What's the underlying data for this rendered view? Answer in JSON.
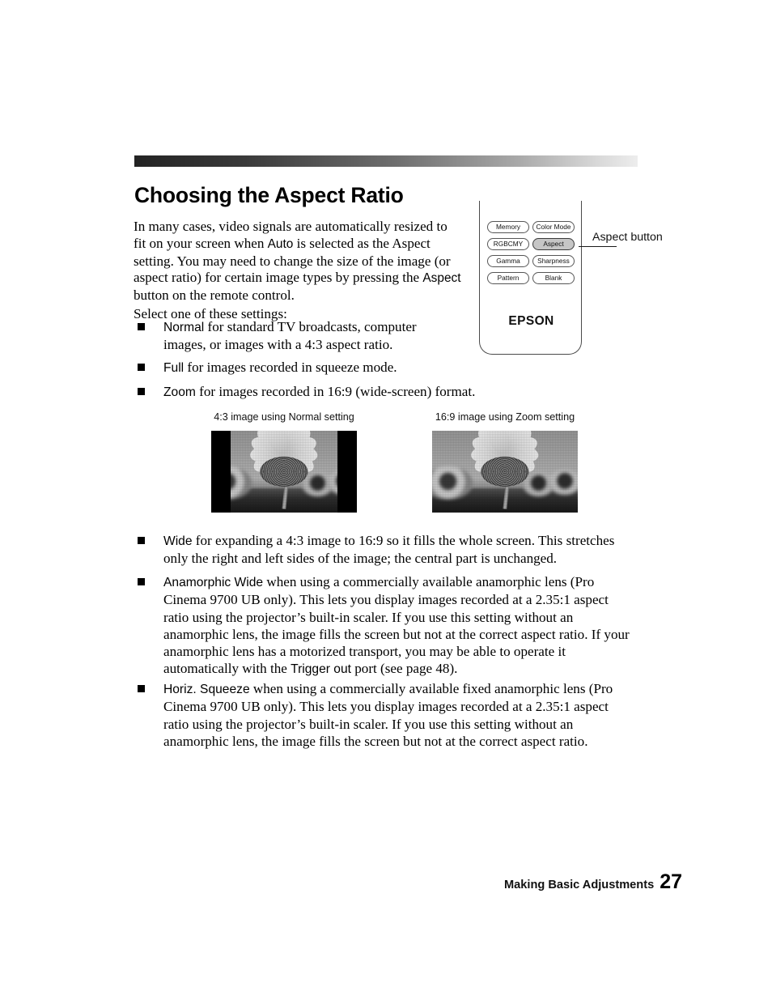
{
  "page": {
    "title": "Choosing the Aspect Ratio",
    "number": "27",
    "footer_label": "Making Basic Adjustments"
  },
  "intro": {
    "part1": "In many cases, video signals are automatically resized to fit on your screen when ",
    "term1": "Auto",
    "part2": " is selected as the Aspect setting. You may need to change the size of the image (or aspect ratio) for certain image types by pressing the ",
    "term2": "Aspect",
    "part3": " button on the remote control.",
    "select_line": "Select one of these settings:"
  },
  "settings_list": [
    {
      "term": "Normal",
      "text": " for standard TV broadcasts, computer images, or images with a 4:3 aspect ratio."
    },
    {
      "term": "Full",
      "text": " for images recorded in squeeze mode."
    },
    {
      "term": "Zoom",
      "text": " for images recorded in 16:9 (wide-screen) format."
    }
  ],
  "settings_list2": [
    {
      "term": "Wide",
      "text": " for expanding a 4:3 image to 16:9 so it fills the whole screen. This stretches only the right and left sides of the image; the central part is unchanged."
    },
    {
      "term": "Anamorphic Wide",
      "text_a": " when using a commercially available anamorphic lens (Pro Cinema 9700 UB only). This lets you display images recorded at a 2.35:1 aspect ratio using the projector’s built-in scaler. If you use this setting without an anamorphic lens, the image fills the screen but not at the correct aspect ratio. If your anamorphic lens has a motorized transport, you may be able to operate it automatically with the ",
      "term_inline": "Trigger out",
      "text_b": " port (see page 48)."
    },
    {
      "term": "Horiz. Squeeze",
      "text": " when using a commercially available fixed anamorphic lens (Pro Cinema 9700 UB only). This lets you display images recorded at a 2.35:1 aspect ratio using the projector’s built-in scaler. If you use this setting without an anamorphic lens, the image fills the screen but not at the correct aspect ratio."
    }
  ],
  "remote": {
    "buttons": [
      {
        "label": "Memory",
        "highlighted": false
      },
      {
        "label": "Color Mode",
        "highlighted": false
      },
      {
        "label": "RGBCMY",
        "highlighted": false
      },
      {
        "label": "Aspect",
        "highlighted": true
      },
      {
        "label": "Gamma",
        "highlighted": false
      },
      {
        "label": "Sharpness",
        "highlighted": false
      },
      {
        "label": "Pattern",
        "highlighted": false
      },
      {
        "label": "Blank",
        "highlighted": false
      }
    ],
    "brand": "EPSON",
    "callout": "Aspect button"
  },
  "figures": [
    {
      "caption": "4:3 image using Normal setting",
      "letterboxed": true
    },
    {
      "caption": "16:9 image using Zoom setting",
      "letterboxed": false
    }
  ],
  "colors": {
    "rule_dark": "#232323",
    "rule_light": "#ededed",
    "highlight": "#c6c6c6",
    "text": "#000000"
  }
}
